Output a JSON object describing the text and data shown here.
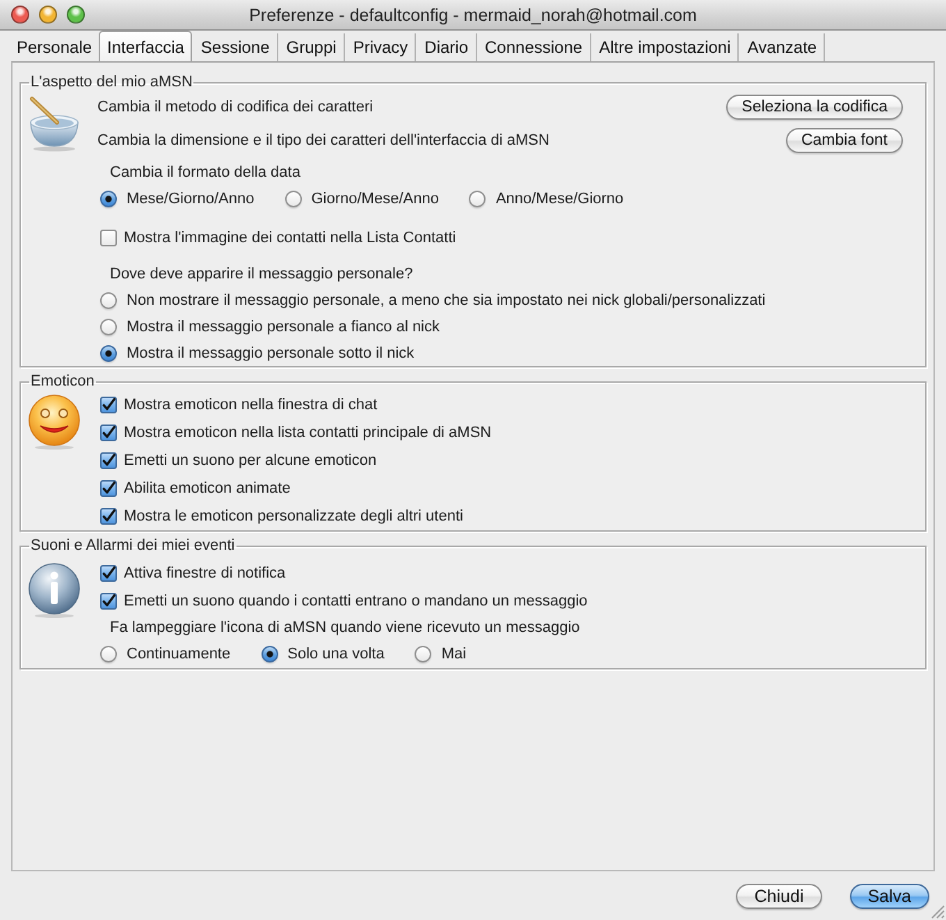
{
  "window": {
    "title": "Preferenze - defaultconfig - mermaid_norah@hotmail.com"
  },
  "tabs": [
    {
      "label": "Personale",
      "selected": false
    },
    {
      "label": "Interfaccia",
      "selected": true
    },
    {
      "label": "Sessione",
      "selected": false
    },
    {
      "label": "Gruppi",
      "selected": false
    },
    {
      "label": "Privacy",
      "selected": false
    },
    {
      "label": "Diario",
      "selected": false
    },
    {
      "label": "Connessione",
      "selected": false
    },
    {
      "label": "Altre impostazioni",
      "selected": false
    },
    {
      "label": "Avanzate",
      "selected": false
    }
  ],
  "groups": [
    {
      "title": "L'aspetto del mio aMSN",
      "items": [
        {
          "kind": "action",
          "label": "Cambia il metodo di codifica dei caratteri",
          "button": "Seleziona la codifica"
        },
        {
          "kind": "action",
          "label": "Cambia la dimensione e il tipo dei caratteri dell'interfaccia di aMSN",
          "button": "Cambia font"
        },
        {
          "kind": "heading",
          "label": "Cambia il formato della data"
        },
        {
          "kind": "radio_row",
          "options": [
            {
              "label": "Mese/Giorno/Anno",
              "selected": true
            },
            {
              "label": "Giorno/Mese/Anno",
              "selected": false
            },
            {
              "label": "Anno/Mese/Giorno",
              "selected": false
            }
          ]
        },
        {
          "kind": "checkbox",
          "label": "Mostra l'immagine dei contatti nella Lista Contatti",
          "checked": false
        },
        {
          "kind": "heading",
          "label": "Dove deve apparire il messaggio personale?"
        },
        {
          "kind": "radio",
          "label": "Non mostrare il messaggio personale, a meno che sia impostato nei nick globali/personalizzati",
          "selected": false
        },
        {
          "kind": "radio",
          "label": "Mostra il messaggio personale a fianco al nick",
          "selected": false
        },
        {
          "kind": "radio",
          "label": "Mostra il messaggio personale sotto il nick",
          "selected": true
        }
      ]
    },
    {
      "title": "Emoticon",
      "items": [
        {
          "kind": "checkbox",
          "label": "Mostra emoticon nella finestra di chat",
          "checked": true
        },
        {
          "kind": "checkbox",
          "label": "Mostra emoticon nella lista contatti principale di aMSN",
          "checked": true
        },
        {
          "kind": "checkbox",
          "label": "Emetti un suono per alcune emoticon",
          "checked": true
        },
        {
          "kind": "checkbox",
          "label": "Abilita emoticon animate",
          "checked": true
        },
        {
          "kind": "checkbox",
          "label": "Mostra le emoticon personalizzate degli altri utenti",
          "checked": true
        }
      ]
    },
    {
      "title": "Suoni e Allarmi dei miei eventi",
      "items": [
        {
          "kind": "checkbox",
          "label": "Attiva finestre di notifica",
          "checked": true
        },
        {
          "kind": "checkbox",
          "label": "Emetti un suono quando i contatti entrano o mandano un messaggio",
          "checked": true
        },
        {
          "kind": "heading",
          "label": "Fa lampeggiare l'icona di aMSN quando viene ricevuto un messaggio"
        },
        {
          "kind": "radio_row",
          "options": [
            {
              "label": "Continuamente",
              "selected": false
            },
            {
              "label": "Solo una volta",
              "selected": true
            },
            {
              "label": "Mai",
              "selected": false
            }
          ]
        }
      ]
    }
  ],
  "buttons": [
    {
      "label": "Chiudi",
      "default": false
    },
    {
      "label": "Salva",
      "default": true
    }
  ]
}
